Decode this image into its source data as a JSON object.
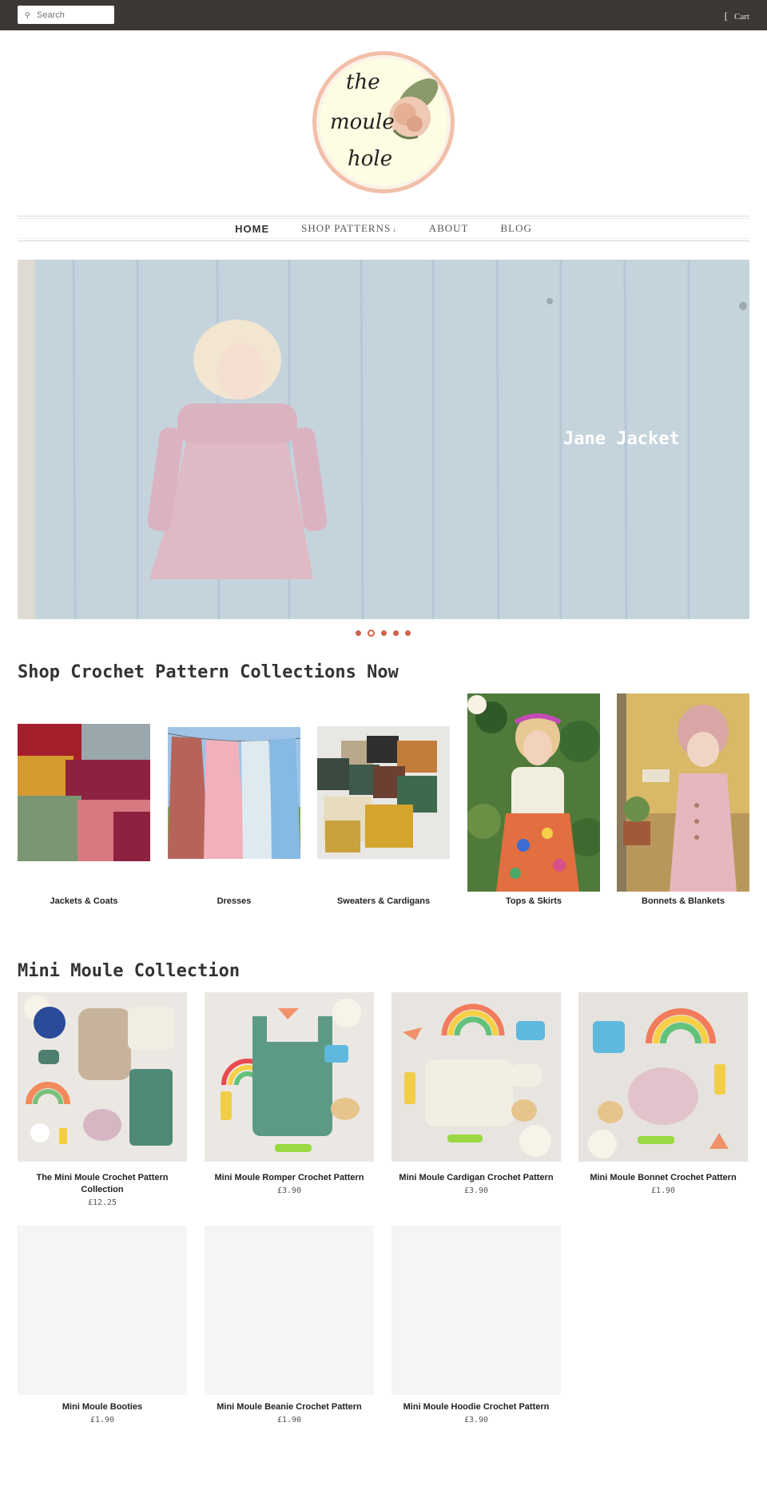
{
  "topbar": {
    "search_placeholder": "Search",
    "search_icon": "search-icon",
    "cart_icon": "[",
    "cart_label": "Cart"
  },
  "logo": {
    "line1": "the",
    "line2": "moule",
    "line3": "hole"
  },
  "nav": {
    "items": [
      {
        "label": "HOME",
        "active": true
      },
      {
        "label": "SHOP PATTERNS",
        "caret": "↓",
        "active": false
      },
      {
        "label": "ABOUT",
        "active": false
      },
      {
        "label": "BLOG",
        "active": false
      }
    ]
  },
  "hero": {
    "caption": "Jane Jacket",
    "slide_count": 5,
    "active_slide": 1
  },
  "collections": {
    "title": "Shop Crochet Pattern Collections Now",
    "items": [
      {
        "label": "Jackets & Coats"
      },
      {
        "label": "Dresses"
      },
      {
        "label": "Sweaters & Cardigans"
      },
      {
        "label": "Tops & Skirts"
      },
      {
        "label": "Bonnets & Blankets"
      }
    ]
  },
  "mini_moule": {
    "title": "Mini Moule Collection",
    "products": [
      {
        "name": "The Mini Moule Crochet Pattern Collection",
        "price": "£12.25"
      },
      {
        "name": "Mini Moule Romper Crochet Pattern",
        "price": "£3.90"
      },
      {
        "name": "Mini Moule Cardigan Crochet Pattern",
        "price": "£3.90"
      },
      {
        "name": "Mini Moule Bonnet Crochet Pattern",
        "price": "£1.90"
      },
      {
        "name": "Mini Moule Booties",
        "price": "£1.90"
      },
      {
        "name": "Mini Moule Beanie Crochet Pattern",
        "price": "£1.90"
      },
      {
        "name": "Mini Moule Hoodie Crochet Pattern",
        "price": "£3.90"
      }
    ]
  },
  "colors": {
    "topbar": "#3c3836",
    "accent": "#d0624d",
    "placeholder_tile": "#f5f5f4"
  }
}
